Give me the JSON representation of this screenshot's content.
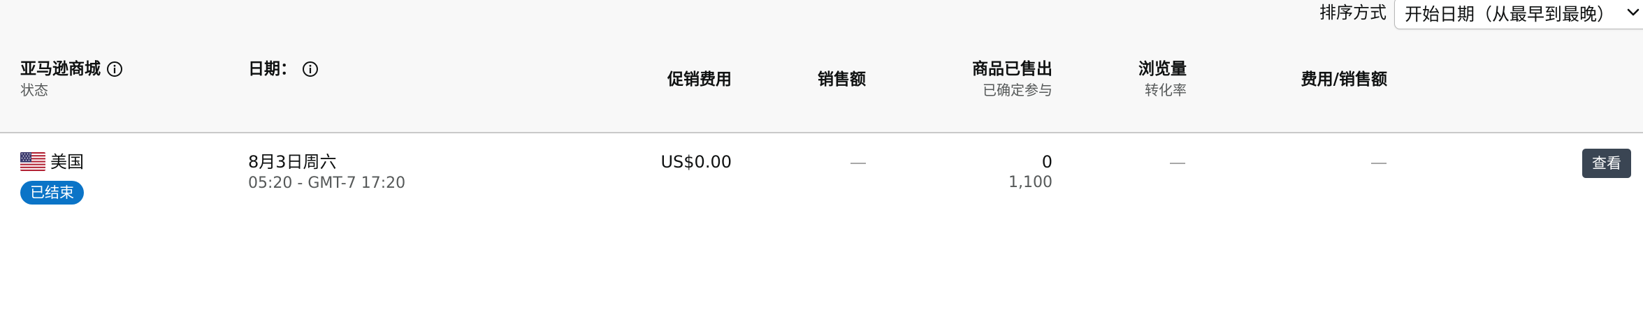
{
  "sort": {
    "label": "排序方式",
    "selected": "开始日期（从最早到最晚）",
    "chevron_icon": "chevron-down-icon"
  },
  "columns": {
    "marketplace": {
      "title": "亚马逊商城",
      "sub": "状态",
      "info_icon": "info-icon"
    },
    "date": {
      "title": "日期：",
      "info_icon": "info-icon"
    },
    "promo_fee": {
      "title": "促销费用"
    },
    "sales": {
      "title": "销售额"
    },
    "units_sold": {
      "title": "商品已售出",
      "sub": "已确定参与"
    },
    "page_views": {
      "title": "浏览量",
      "sub": "转化率"
    },
    "fee_to_sales": {
      "title": "费用/销售额"
    }
  },
  "rows": [
    {
      "marketplace": "美国",
      "flag_icon": "us-flag-icon",
      "status": "已结束",
      "date": "8月3日周六",
      "time": "05:20 - GMT-7 17:20",
      "promo_fee": "US$0.00",
      "units_sold": "0",
      "committed": "1,100",
      "action_label": "查看"
    }
  ],
  "colors": {
    "status_badge": "#0b74c7",
    "view_button": "#3a4553",
    "header_bg": "#f8f8f8"
  }
}
